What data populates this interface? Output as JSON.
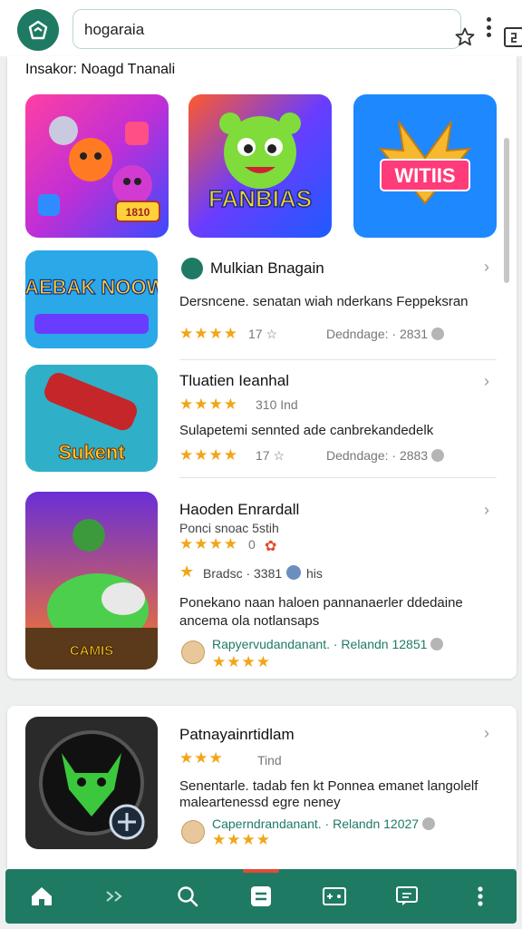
{
  "search": {
    "query": "hogaraia"
  },
  "section": {
    "title": "Insakor: Noagd Tnanali"
  },
  "featured": [
    {
      "name": "candy-monsters-game",
      "badge": "1810",
      "colors": [
        "#ff3fa2",
        "#ff8a2a",
        "#7b3cff"
      ]
    },
    {
      "name": "fanbias-game",
      "label": "FANBIAS",
      "colors": [
        "#2a6bff",
        "#ff5a2a",
        "#ffcf2a"
      ]
    },
    {
      "name": "wings-game",
      "label": "WITIIS",
      "colors": [
        "#1e88ff",
        "#f5b82e",
        "#ff3b7a"
      ]
    }
  ],
  "list": [
    {
      "title": "Mulkian Bnagain",
      "desc": "Dersncene. senatan wiah nderkans Feppeksran",
      "rating_stars": "★★★★",
      "rating_text": "17 ☆",
      "meta": "Dedndage: · 2831",
      "thumb_label": "SAEBAK NOOW!"
    },
    {
      "title": "Tluatien Ieanhal",
      "rating_stars": "★★★★",
      "rating_text": "310  Ind",
      "desc": "Sulapetemi sennted ade canbrekandedelk",
      "rating_stars2": "★★★★",
      "rating_text2": "17 ☆",
      "meta": "Dedndage: · 2883",
      "thumb_label": "Sukent"
    },
    {
      "title": "Haoden Enrardall",
      "subtitle": "Ponci snoac 5stih",
      "rating_stars": "★★★★",
      "rating_text": "0",
      "badge_line": "Bradsc · 3381",
      "badge_extra": "his",
      "desc_line1": "Ponekano naan haloen pannanaerler ddedaine",
      "desc_line2": "ancema ola notlansaps",
      "dev": "Rapyervudandanant. · Relandn 12851",
      "dev_stars": "★★★★",
      "thumb_label": "CAMIS"
    }
  ],
  "card2": {
    "title": "Patnayainrtidlam",
    "rating_stars": "★★★",
    "rating_text": "Tind",
    "desc_line1": "Senentarle. tadab fen kt Ponnea emanet langolelf",
    "desc_line2": "maleartenessd egre neney",
    "dev": "Caperndrandanant. · Relandn 12027",
    "dev_stars": "★★★★"
  },
  "nav": [
    {
      "name": "home"
    },
    {
      "name": "forward"
    },
    {
      "name": "search"
    },
    {
      "name": "library",
      "active": true
    },
    {
      "name": "games"
    },
    {
      "name": "chat"
    },
    {
      "name": "more"
    }
  ]
}
